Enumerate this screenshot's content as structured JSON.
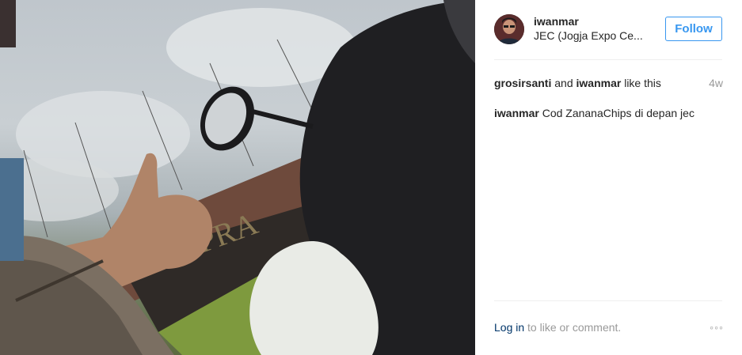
{
  "post": {
    "username": "iwanmar",
    "location": "JEC (Jogja Expo Ce...",
    "follow_label": "Follow",
    "likes": {
      "user1": "grosirsanti",
      "connector": " and ",
      "user2": "iwanmar",
      "suffix": " like this"
    },
    "age": "4w",
    "caption": {
      "author": "iwanmar",
      "text": "Cod ZananaChips di depan jec"
    }
  },
  "footer": {
    "login_label": "Log in",
    "login_suffix": " to like or comment.",
    "more_icon": "more-dots-icon",
    "more_glyph": "◦◦◦"
  },
  "colors": {
    "accent": "#3897f0",
    "link_dark": "#003569",
    "muted": "#999999",
    "text": "#262626"
  }
}
